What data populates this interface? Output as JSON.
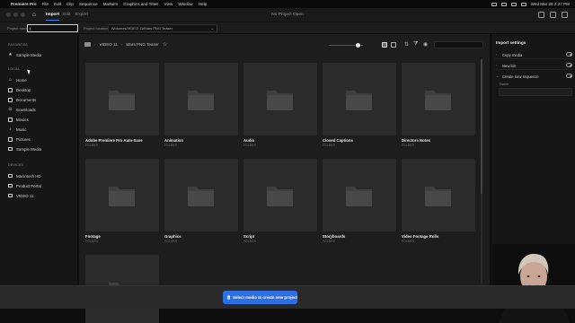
{
  "menubar": {
    "items": [
      "Premiere Pro",
      "File",
      "Edit",
      "Clip",
      "Sequence",
      "Markers",
      "Graphics and Titles",
      "View",
      "Window",
      "Help"
    ],
    "clock": "Wed Mar 29 2:27 PM"
  },
  "header": {
    "tabs": [
      "Import",
      "Edit",
      "Export"
    ],
    "active_tab": "Import",
    "title": "No Project Open"
  },
  "project_bar": {
    "name_label": "Project name",
    "name_value": "|",
    "location_label": "Project location",
    "location_value": "/Volumes/VIDEO 11/Mars PNG Teaser"
  },
  "sidebar": {
    "favorites_heading": "FAVORITES",
    "favorites": [
      {
        "label": "Sample Media",
        "icon": "star-icon"
      }
    ],
    "local_heading": "LOCAL",
    "local": [
      {
        "label": "Home",
        "icon": "home-icon"
      },
      {
        "label": "Desktop",
        "icon": "desktop-icon"
      },
      {
        "label": "Documents",
        "icon": "documents-icon"
      },
      {
        "label": "Downloads",
        "icon": "downloads-icon"
      },
      {
        "label": "Movies",
        "icon": "movies-icon"
      },
      {
        "label": "Music",
        "icon": "music-icon"
      },
      {
        "label": "Pictures",
        "icon": "pictures-icon"
      },
      {
        "label": "Sample Media",
        "icon": "folder-icon"
      }
    ],
    "devices_heading": "DEVICES",
    "devices": [
      {
        "label": "Macintosh HD",
        "icon": "drive-icon"
      },
      {
        "label": "Product Portal",
        "icon": "drive-icon"
      },
      {
        "label": "VIDEO 11",
        "icon": "drive-icon"
      }
    ]
  },
  "browser": {
    "breadcrumb": [
      "VIDEO 11",
      "Mars PNG Teaser"
    ],
    "folders": [
      {
        "name": "Adobe Premiere Pro Auto-Save",
        "type": "FOLDER"
      },
      {
        "name": "Animation",
        "type": "FOLDER"
      },
      {
        "name": "Audio",
        "type": "FOLDER"
      },
      {
        "name": "Closed Captions",
        "type": "FOLDER"
      },
      {
        "name": "Directors Notes",
        "type": "FOLDER"
      },
      {
        "name": "Footage",
        "type": "FOLDER"
      },
      {
        "name": "Graphics",
        "type": "FOLDER"
      },
      {
        "name": "Script",
        "type": "FOLDER"
      },
      {
        "name": "Storyboards",
        "type": "FOLDER"
      },
      {
        "name": "Video Footage Rolls",
        "type": "FOLDER"
      },
      {
        "name": "",
        "type": ""
      }
    ]
  },
  "import_settings": {
    "title": "Import settings",
    "options": [
      "Copy media",
      "New bin",
      "Create new sequence"
    ],
    "name_label": "Name"
  },
  "cta": {
    "label": "Select media to create new project"
  },
  "colors": {
    "accent": "#2d6fe0"
  }
}
